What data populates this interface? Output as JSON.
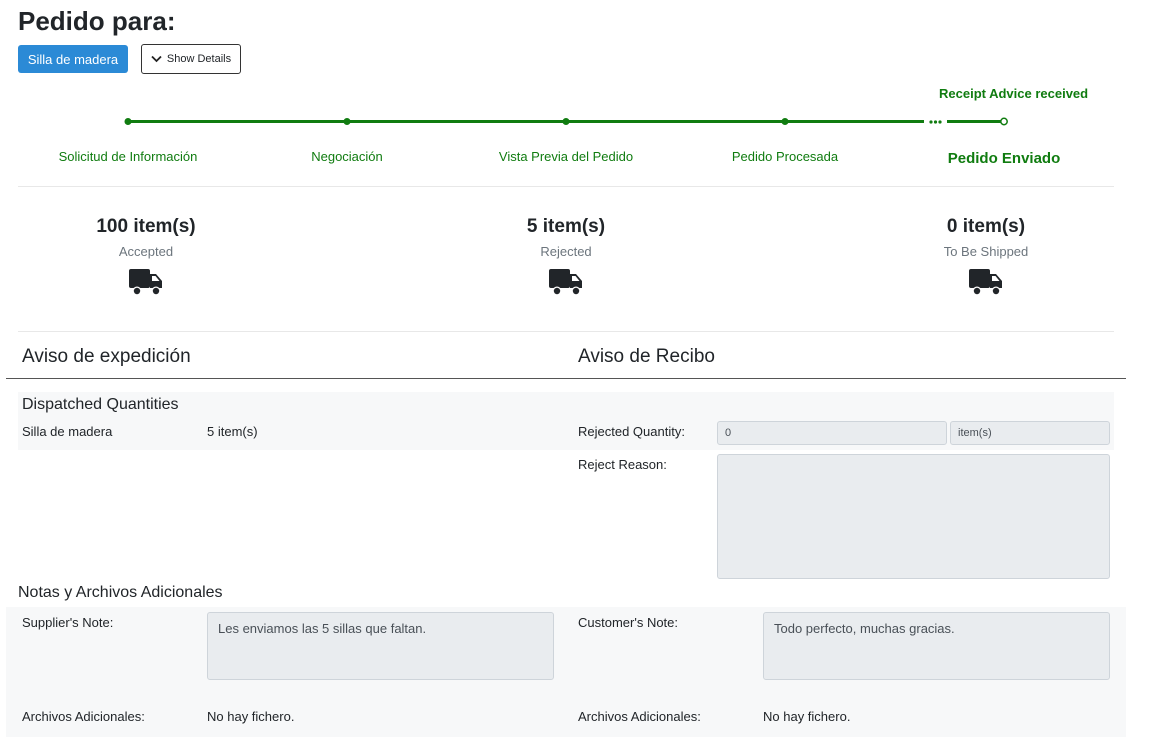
{
  "header": {
    "title": "Pedido para:",
    "product_button": "Silla de madera",
    "details_button": "Show Details"
  },
  "progress": {
    "receipt_message": "Receipt Advice received",
    "steps": [
      {
        "label": "Solicitud de Información",
        "state": "done"
      },
      {
        "label": "Negociación",
        "state": "done"
      },
      {
        "label": "Vista Previa del Pedido",
        "state": "done"
      },
      {
        "label": "Pedido Procesada",
        "state": "done"
      },
      {
        "label": "Pedido Enviado",
        "state": "current"
      }
    ],
    "color": "#107c10"
  },
  "stats": [
    {
      "count": "100 item(s)",
      "label": "Accepted",
      "icon": "truck-icon"
    },
    {
      "count": "5 item(s)",
      "label": "Rejected",
      "icon": "truck-icon"
    },
    {
      "count": "0 item(s)",
      "label": "To Be Shipped",
      "icon": "truck-icon"
    }
  ],
  "dispatch": {
    "title": "Aviso de expedición",
    "subtitle": "Dispatched Quantities",
    "item_name": "Silla de madera",
    "item_qty": "5 item(s)"
  },
  "receipt": {
    "title": "Aviso de Recibo",
    "rejected_label": "Rejected Quantity:",
    "rejected_value": "0",
    "rejected_unit": "item(s)",
    "reason_label": "Reject Reason:",
    "reason_value": ""
  },
  "notes": {
    "title": "Notas y Archivos Adicionales",
    "supplier_label": "Supplier's Note:",
    "supplier_value": "Les enviamos las 5 sillas que faltan.",
    "customer_label": "Customer's Note:",
    "customer_value": "Todo perfecto, muchas gracias.",
    "files_label": "Archivos Adicionales:",
    "supplier_files": "No hay fichero.",
    "customer_files": "No hay fichero."
  },
  "colors": {
    "primary": "#2b8ad6",
    "success": "#107c10",
    "muted": "#6c757d",
    "readonly_bg": "#e9ecef"
  }
}
